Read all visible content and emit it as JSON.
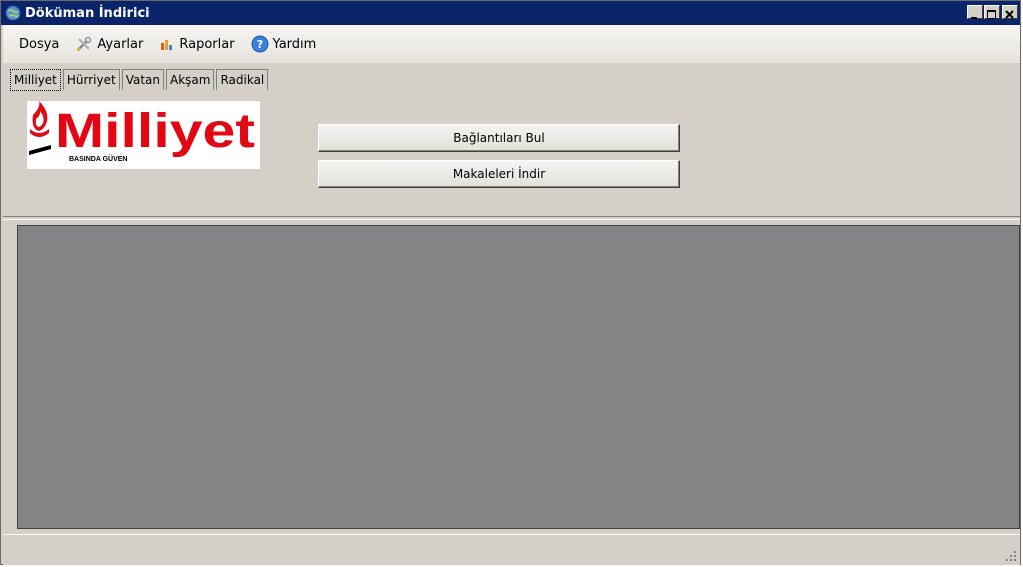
{
  "window": {
    "title": "Döküman İndirici",
    "title_icon": "globe-icon",
    "controls": [
      "minimize-icon",
      "maximize-icon",
      "close-icon"
    ]
  },
  "menu": {
    "items": [
      {
        "label": "Dosya",
        "icon": null
      },
      {
        "label": "Ayarlar",
        "icon": "tools-icon"
      },
      {
        "label": "Raporlar",
        "icon": "chart-icon"
      },
      {
        "label": "Yardım",
        "icon": "help-icon"
      }
    ]
  },
  "tabs": [
    {
      "label": "Milliyet",
      "active": true
    },
    {
      "label": "Hürriyet",
      "active": false
    },
    {
      "label": "Vatan",
      "active": false
    },
    {
      "label": "Akşam",
      "active": false
    },
    {
      "label": "Radikal",
      "active": false
    }
  ],
  "logo": {
    "text": "Milliyet",
    "tagline": "BASINDA GÜVEN",
    "color": "#e30613"
  },
  "buttons": {
    "find_links": "Bağlantıları Bul",
    "download_articles": "Makaleleri İndir"
  },
  "colors": {
    "title_bar": "#0a246a",
    "content_bg": "#858386",
    "window_bg": "#d4d0c8"
  }
}
